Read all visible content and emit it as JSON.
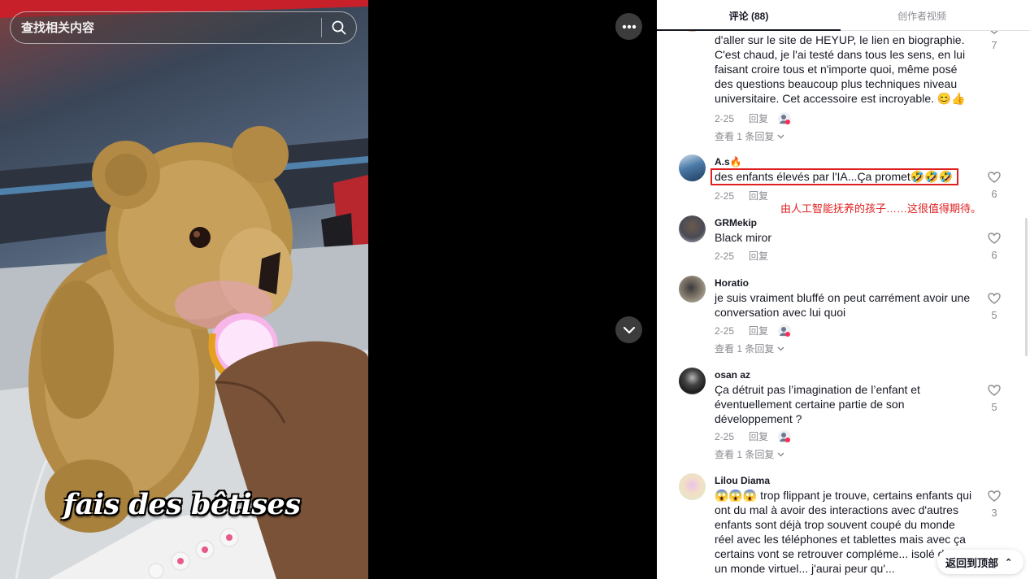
{
  "search": {
    "placeholder": "查找相关内容"
  },
  "video": {
    "caption": "fais des bêtises"
  },
  "tabs": {
    "comments": "评论 (88)",
    "creator_videos": "创作者视频"
  },
  "reply_label": "回复",
  "comments": [
    {
      "username": "",
      "text": "d'aller sur le site de HEYUP, le lien en biographie. C'est chaud, je l'ai testé dans tous les sens, en lui faisant croire tous et n'importe quoi, même posé des questions beaucoup plus techniques niveau universitaire. Cet accessoire est incroyable. 😊👍",
      "date": "2-25",
      "likes": "7",
      "view_replies": "查看 1 条回复"
    },
    {
      "username": "A.s🔥",
      "text": "des enfants élevés par l'IA...Ça promet🤣🤣🤣",
      "date": "2-25",
      "likes": "6",
      "translation_note": "由人工智能抚养的孩子……这很值得期待。"
    },
    {
      "username": "GRMekip",
      "text": "Black miror",
      "date": "2-25",
      "likes": "6"
    },
    {
      "username": "Horatio",
      "text": "je suis vraiment bluffé on peut carrément avoir une conversation avec lui quoi",
      "date": "2-25",
      "likes": "5",
      "view_replies": "查看 1 条回复"
    },
    {
      "username": "osan az",
      "text": "Ça détruit pas l’imagination de l’enfant et éventuellement certaine partie de son développement ?",
      "date": "2-25",
      "likes": "5",
      "view_replies": "查看 1 条回复"
    },
    {
      "username": "Lilou Diama",
      "text": "😱😱😱 trop flippant je trouve, certains enfants qui ont du mal à avoir des interactions avec d'autres enfants sont déjà trop souvent coupé du monde réel avec les téléphones et tablettes mais avec ça certains vont se retrouver compléme... isolé dans un monde virtuel... j'aurai peur qu'...",
      "likes": "3"
    }
  ],
  "back_to_top": "返回到顶部",
  "icons": {
    "search": "search-icon",
    "more": "more-horizontal-icon",
    "scroll_down": "chevron-down-icon",
    "like": "heart-outline-icon",
    "creator_badge": "creator-badge-icon",
    "back_to_top": "double-chevron-up-icon"
  },
  "colors": {
    "highlight": "#e02020",
    "text": "#161823",
    "muted": "#8a8b91"
  }
}
